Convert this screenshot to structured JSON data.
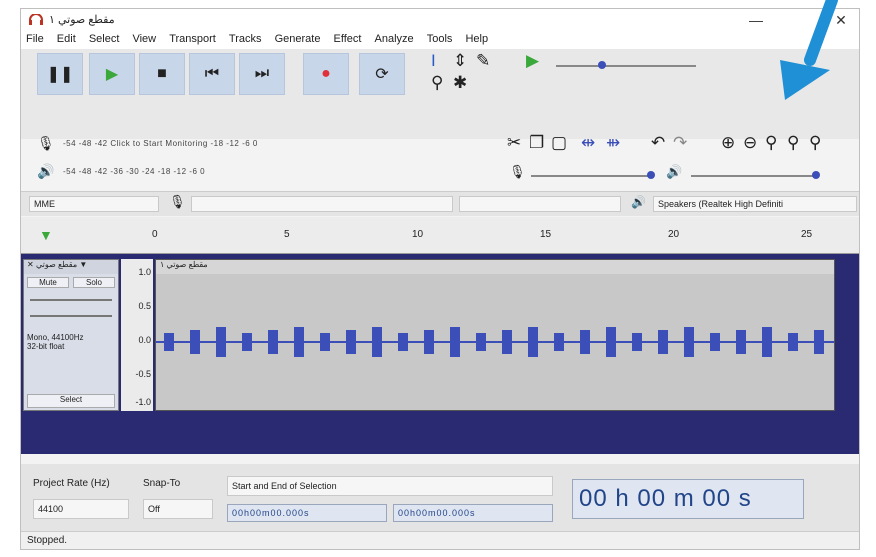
{
  "window": {
    "title": "مقطع صوتي ١",
    "minimize": "—",
    "close": "✕"
  },
  "menu": [
    "File",
    "Edit",
    "Select",
    "View",
    "Transport",
    "Tracks",
    "Generate",
    "Effect",
    "Analyze",
    "Tools",
    "Help"
  ],
  "transport": {
    "pause": "❚❚",
    "play": "▶",
    "stop": "■",
    "skip_start": "⏮",
    "skip_end": "⏭",
    "record": "●",
    "loop": "⟳"
  },
  "meters": {
    "record_scale": "-54   -48   -42   Click to Start Monitoring   -18   -12   -6   0",
    "play_scale": "-54   -48   -42   -36   -30   -24   -18   -12   -6   0"
  },
  "device": {
    "host": "MME",
    "output": "Speakers (Realtek High Definiti"
  },
  "ruler": {
    "labels": [
      "0",
      "5",
      "10",
      "15",
      "20",
      "25"
    ]
  },
  "track": {
    "name": "مقطع صوتي",
    "clip_name": "مقطع صوتي ١",
    "mute": "Mute",
    "solo": "Solo",
    "info": "Mono, 44100Hz\n32-bit float",
    "select": "Select",
    "scale": [
      "1.0",
      "0.5",
      "0.0",
      "-0.5",
      "-1.0"
    ]
  },
  "bottom": {
    "project_rate_label": "Project Rate (Hz)",
    "project_rate_value": "44100",
    "snap_to_label": "Snap-To",
    "snap_to_value": "Off",
    "selection_label": "Start and End of Selection",
    "sel_start": "00h00m00.000s",
    "sel_end": "00h00m00.000s",
    "time_display": "00 h 00 m 00 s"
  },
  "status": "Stopped.",
  "colors": {
    "accent": "#2a73c9",
    "waveform": "#3c4fb8",
    "arrow": "#1f8fd6"
  }
}
